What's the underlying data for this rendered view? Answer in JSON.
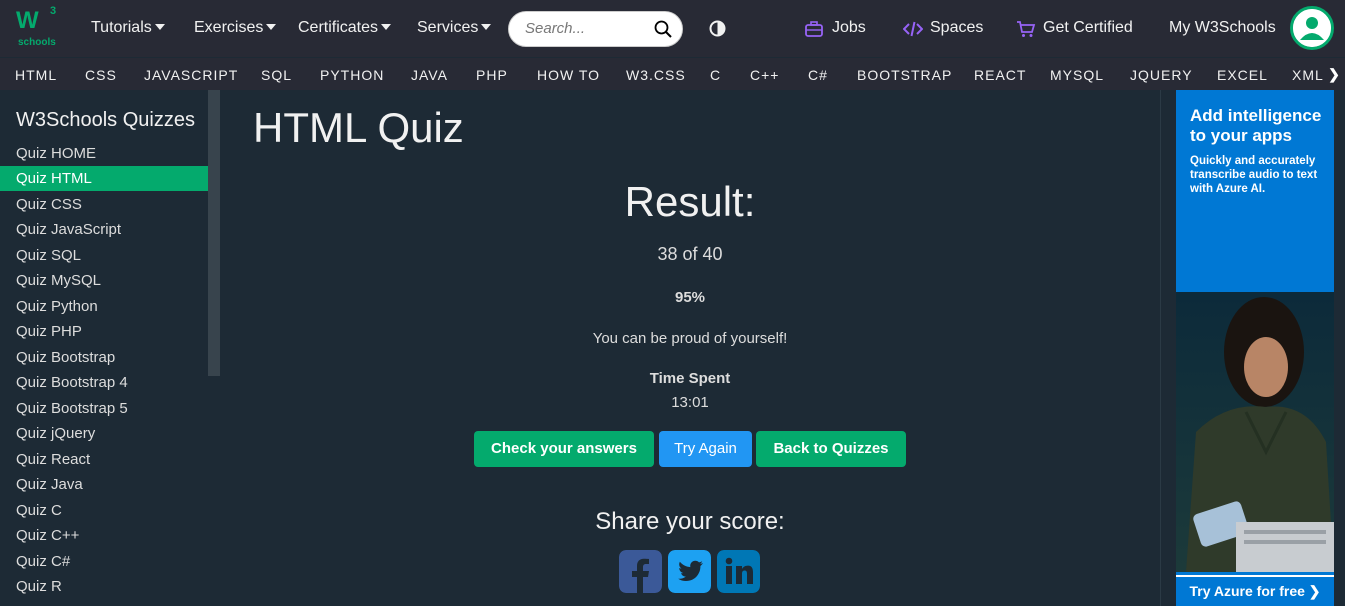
{
  "logo": {
    "main": "W",
    "sup": "3",
    "sub": "schools"
  },
  "topnav": {
    "tutorials": "Tutorials",
    "exercises": "Exercises",
    "certificates": "Certificates",
    "services": "Services",
    "jobs": "Jobs",
    "spaces": "Spaces",
    "get_certified": "Get Certified",
    "my_w3schools": "My W3Schools"
  },
  "search": {
    "placeholder": "Search..."
  },
  "subjects": [
    "HTML",
    "CSS",
    "JAVASCRIPT",
    "SQL",
    "PYTHON",
    "JAVA",
    "PHP",
    "HOW TO",
    "W3.CSS",
    "C",
    "C++",
    "C#",
    "BOOTSTRAP",
    "REACT",
    "MYSQL",
    "JQUERY",
    "EXCEL",
    "XML"
  ],
  "sidebar": {
    "title": "W3Schools Quizzes",
    "items": [
      "Quiz HOME",
      "Quiz HTML",
      "Quiz CSS",
      "Quiz JavaScript",
      "Quiz SQL",
      "Quiz MySQL",
      "Quiz Python",
      "Quiz PHP",
      "Quiz Bootstrap",
      "Quiz Bootstrap 4",
      "Quiz Bootstrap 5",
      "Quiz jQuery",
      "Quiz React",
      "Quiz Java",
      "Quiz C",
      "Quiz C++",
      "Quiz C#",
      "Quiz R"
    ],
    "active": "Quiz HTML"
  },
  "main": {
    "title": "HTML Quiz",
    "result_title": "Result:",
    "score": "38 of 40",
    "percent": "95%",
    "message": "You can be proud of yourself!",
    "time_label": "Time Spent",
    "time_value": "13:01",
    "buttons": {
      "check": "Check your answers",
      "try_again": "Try Again",
      "back": "Back to Quizzes"
    },
    "share_title": "Share your score:",
    "share_icons": [
      "facebook-icon",
      "twitter-icon",
      "linkedin-icon"
    ]
  },
  "ad": {
    "headline": "Add intelligence to your apps",
    "subtext": "Quickly and accurately transcribe audio to text with Azure AI.",
    "cta": "Try Azure for free ❯"
  },
  "colors": {
    "accent": "#04aa6d",
    "button_blue": "#2196f3",
    "background": "#1d2a35",
    "topbar": "#282a35",
    "ad_blue": "#0078d4"
  }
}
